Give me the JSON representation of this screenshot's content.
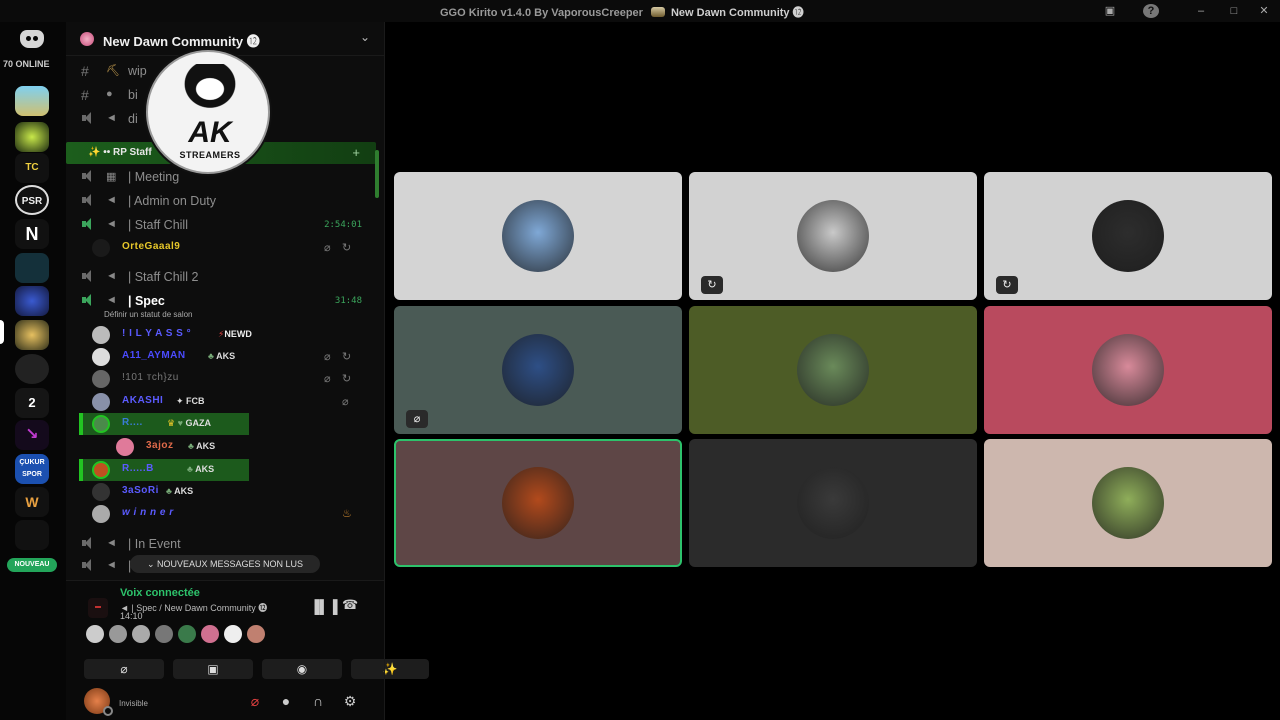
{
  "window": {
    "title": "GGO Kirito v1.4.0 By VaporousCreeper",
    "server_title": "New Dawn Community ⓬"
  },
  "rail": {
    "online_label": "70 ONLINE",
    "number_badge": "2",
    "nouveau_label": "NOUVEAU",
    "servers": [
      "TC",
      "PSR",
      "N",
      "ÇUKUR SPOR",
      "W"
    ]
  },
  "server": {
    "name": "New Dawn Community ⓬"
  },
  "channels": {
    "top": [
      {
        "name": "wip"
      },
      {
        "name": "bi"
      },
      {
        "name": "di"
      }
    ],
    "category": "✨ •• RP Staff",
    "meeting": "| Meeting",
    "admin": "| Admin on Duty",
    "staff_chill": "| Staff Chill",
    "staff_chill_timer": "2:54:01",
    "staff_chill_user": "OrteGaaal9",
    "staff_chill_2": "| Staff Chill 2",
    "spec": "| Spec",
    "spec_timer": "31:48",
    "spec_status": "Définir un statut de salon",
    "in_event": "| In Event",
    "last_channel": "| "
  },
  "spec_users": [
    {
      "name": "! I L Y A S S °",
      "tag": "NEWD",
      "color": "#5b5bff"
    },
    {
      "name": "A11_AYMAN",
      "tag": "AKS",
      "color": "#4b4bff"
    },
    {
      "name": "!101 тch}zu",
      "tag": "",
      "color": "#777777"
    },
    {
      "name": "AKASHI",
      "tag": "FCB",
      "color": "#5b5bff"
    },
    {
      "name": "R....",
      "tag": "GAZA",
      "color": "#3a7bd5"
    },
    {
      "name": "3ajoz",
      "tag": "AKS",
      "color": "#e06a4a"
    },
    {
      "name": "R.....B",
      "tag": "AKS",
      "color": "#5b5bff"
    },
    {
      "name": "3aSoRi",
      "tag": "AKS",
      "color": "#5b5bff"
    },
    {
      "name": "w i n n e r",
      "tag": "",
      "color": "#5b5bff"
    }
  ],
  "unread_pill": "NOUVEAUX MESSAGES NON LUS",
  "voice": {
    "title": "Voix connectée",
    "channel": "| Spec / New Dawn Community ⓬",
    "time": "14:10"
  },
  "self": {
    "status": "Invisible"
  },
  "watermark": {
    "main": "AK",
    "sub": "STREAMERS"
  },
  "tiles": [
    {
      "bg": "#d4d4d4",
      "avatar_color": "#7fa8d6",
      "badge": ""
    },
    {
      "bg": "#d2d2d2",
      "avatar_color": "#c9c9c9",
      "badge": "↻"
    },
    {
      "bg": "#d2d2d2",
      "avatar_color": "#2d2d2d",
      "badge": "↻"
    },
    {
      "bg": "#4a5a55",
      "avatar_color": "#2e4f86",
      "badge": "⌀"
    },
    {
      "bg": "#4d5c26",
      "avatar_color": "#6a8a5a",
      "badge": ""
    },
    {
      "bg": "#b94a5e",
      "avatar_color": "#d88a9a",
      "badge": ""
    },
    {
      "bg": "#5e4646",
      "avatar_color": "#b24a1c",
      "badge": ""
    },
    {
      "bg": "#2b2b2b",
      "avatar_color": "#3a3a3a",
      "badge": ""
    },
    {
      "bg": "#cdb7ae",
      "avatar_color": "#8fae5a",
      "badge": ""
    }
  ]
}
